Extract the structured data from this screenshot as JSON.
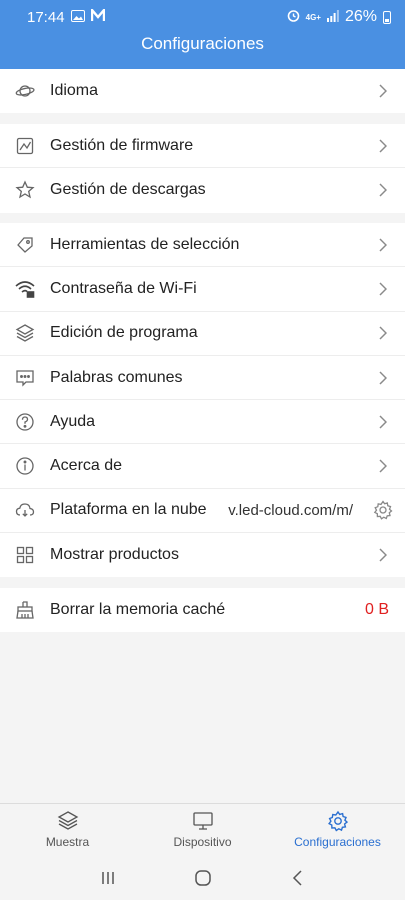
{
  "status_bar": {
    "time": "17:44",
    "signal_text": "4G+",
    "battery_percent": "26%"
  },
  "header": {
    "title": "Configuraciones"
  },
  "groups": [
    {
      "items": [
        {
          "label": "Idioma",
          "icon": "planet-icon"
        }
      ]
    },
    {
      "items": [
        {
          "label": "Gestión de firmware",
          "icon": "firmware-chart-icon"
        },
        {
          "label": "Gestión de descargas",
          "icon": "star-icon"
        }
      ]
    },
    {
      "items": [
        {
          "label": "Herramientas de selección",
          "icon": "tag-icon"
        },
        {
          "label": "Contraseña de Wi-Fi",
          "icon": "wifi-lock-icon"
        },
        {
          "label": "Edición de programa",
          "icon": "layers-icon"
        },
        {
          "label": "Palabras comunes",
          "icon": "message-icon"
        },
        {
          "label": "Ayuda",
          "icon": "help-icon"
        },
        {
          "label": "Acerca de",
          "icon": "info-icon"
        },
        {
          "label": "Plataforma en la nube",
          "icon": "cloud-icon",
          "value": "v.led-cloud.com/m/"
        },
        {
          "label": "Mostrar productos",
          "icon": "grid-icon"
        }
      ]
    },
    {
      "items": [
        {
          "label": "Borrar la memoria caché",
          "icon": "broom-icon",
          "value": "0 B"
        }
      ]
    }
  ],
  "tabbar": {
    "tabs": [
      {
        "label": "Muestra",
        "icon": "layers-icon"
      },
      {
        "label": "Dispositivo",
        "icon": "monitor-icon"
      },
      {
        "label": "Configuraciones",
        "icon": "gear-icon",
        "active": true
      }
    ]
  },
  "colors": {
    "header_bg": "#4a90e2",
    "active_tab": "#2a6fd0",
    "cache_value": "#e02020"
  }
}
